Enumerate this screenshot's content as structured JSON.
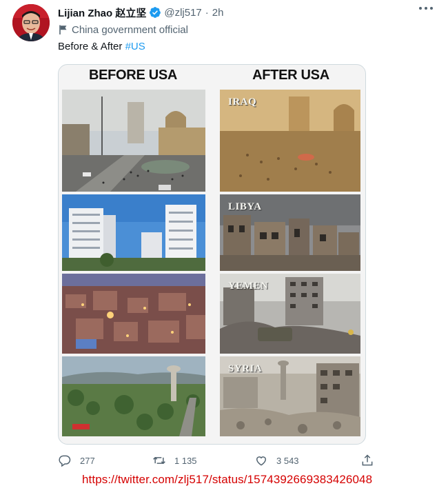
{
  "tweet": {
    "author_name": "Lijian Zhao 赵立坚",
    "handle": "@zlj517",
    "separator": "·",
    "time": "2h",
    "account_label": "China government official",
    "text_prefix": "Before & After ",
    "hashtag": "#US"
  },
  "media": {
    "before_title": "BEFORE USA",
    "after_title": "AFTER USA",
    "after_labels": [
      "IRAQ",
      "LIBYA",
      "YEMEN",
      "SYRIA"
    ]
  },
  "actions": {
    "replies": "277",
    "retweets": "1 135",
    "likes": "3 543"
  },
  "source_url": "https://twitter.com/zlj517/status/1574392669383426048",
  "colors": {
    "link": "#1d9bf0",
    "secondary_text": "#536471",
    "url_overlay": "#d50000",
    "verified_badge": "#1d9bf0"
  },
  "icons": [
    "verified-icon",
    "more-options-icon",
    "flag-icon",
    "reply-icon",
    "retweet-icon",
    "like-icon",
    "share-icon"
  ]
}
